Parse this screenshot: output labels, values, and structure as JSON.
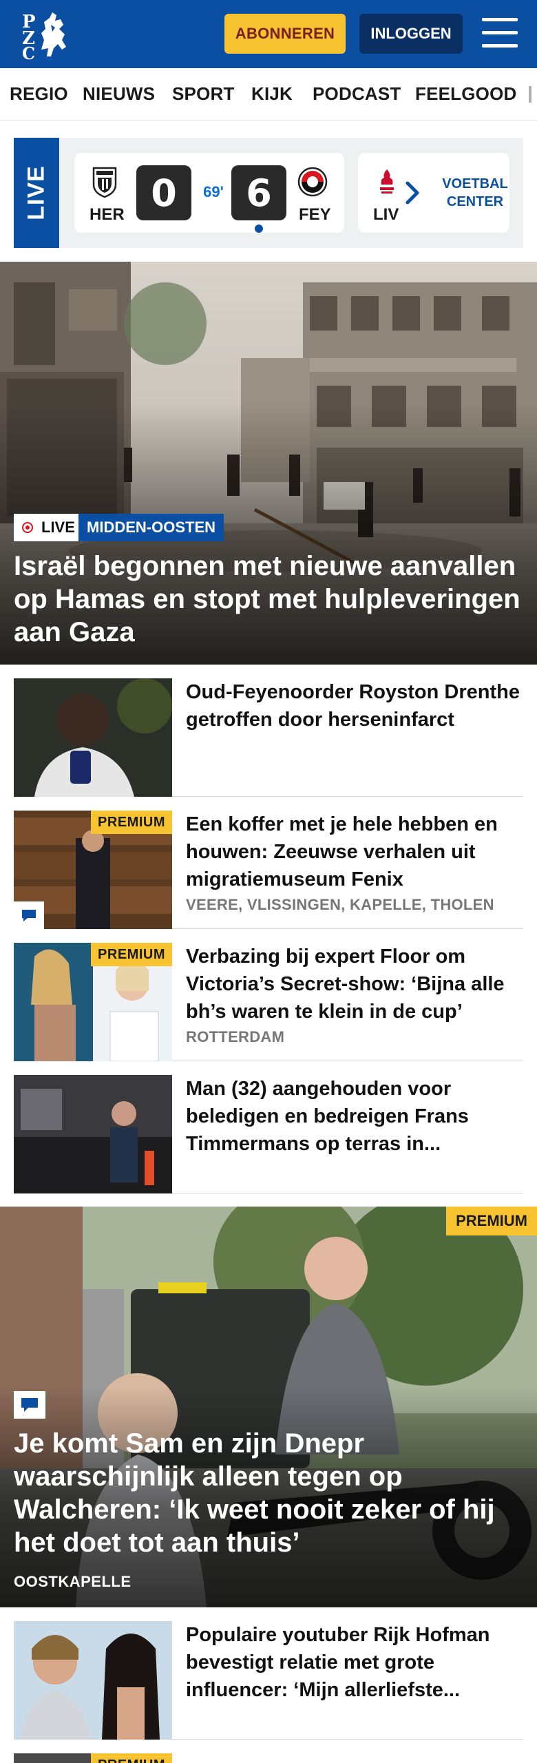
{
  "header": {
    "logo_letters": "PZC",
    "subscribe_label": "ABONNEREN",
    "login_label": "INLOGGEN",
    "menu_icon": "hamburger-icon",
    "brand_color": "#0b4fa3",
    "accent_color": "#f7c330"
  },
  "nav": {
    "items": [
      {
        "label": "REGIO"
      },
      {
        "label": "NIEUWS"
      },
      {
        "label": "SPORT"
      },
      {
        "label": "KIJK"
      },
      {
        "label": "PODCAST"
      },
      {
        "label": "FEELGOOD"
      }
    ]
  },
  "live_strip": {
    "live_label": "LIVE",
    "match": {
      "home_code": "HER",
      "home_score": "0",
      "minute": "69'",
      "away_score": "6",
      "away_code": "FEY"
    },
    "next_match_code": "LIV",
    "next_icon": "chevron-right-icon",
    "voetbal_center_label": "VOETBAL CENTER"
  },
  "hero": {
    "live_label": "LIVE",
    "section_label": "MIDDEN-OOSTEN",
    "title": "Israël begonnen met nieuwe aanvallen op Hamas en stopt met hulpleveringen aan Gaza"
  },
  "articles": [
    {
      "title": "Oud-Feyenoorder Royston Drenthe getroffen door hersen­infarct",
      "meta": "",
      "premium": ""
    },
    {
      "title": "Een koffer met je hele hebben en houwen: Zeeuwse verhalen uit migratiemuseum Fenix",
      "meta": "VEERE, VLISSINGEN, KAPELLE, THOLEN",
      "premium": "PREMIUM"
    },
    {
      "title": "Verbazing bij expert Floor om Victoria’s Secret-show: ‘Bijna alle bh’s waren te klein in de cup’",
      "meta": "ROTTERDAM",
      "premium": "PREMIUM"
    },
    {
      "title": "Man (32) aangehouden voor beledigen en bedreigen Frans Timmermans op terras in...",
      "meta": "",
      "premium": ""
    }
  ],
  "feature": {
    "premium": "PREMIUM",
    "title": "Je komt Sam en zijn Dnepr waarschijnlijk alleen tegen op Walcheren: ‘Ik weet nooit zeker of hij het doet tot aan thuis’",
    "meta": "OOSTKAPELLE"
  },
  "articles_bottom": [
    {
      "title": "Populaire youtuber Rijk Hofman bevestigt relatie met grote influencer: ‘Mijn allerliefste...",
      "meta": "",
      "premium": ""
    },
    {
      "title": "",
      "meta": "",
      "premium": "PREMIUM"
    }
  ]
}
